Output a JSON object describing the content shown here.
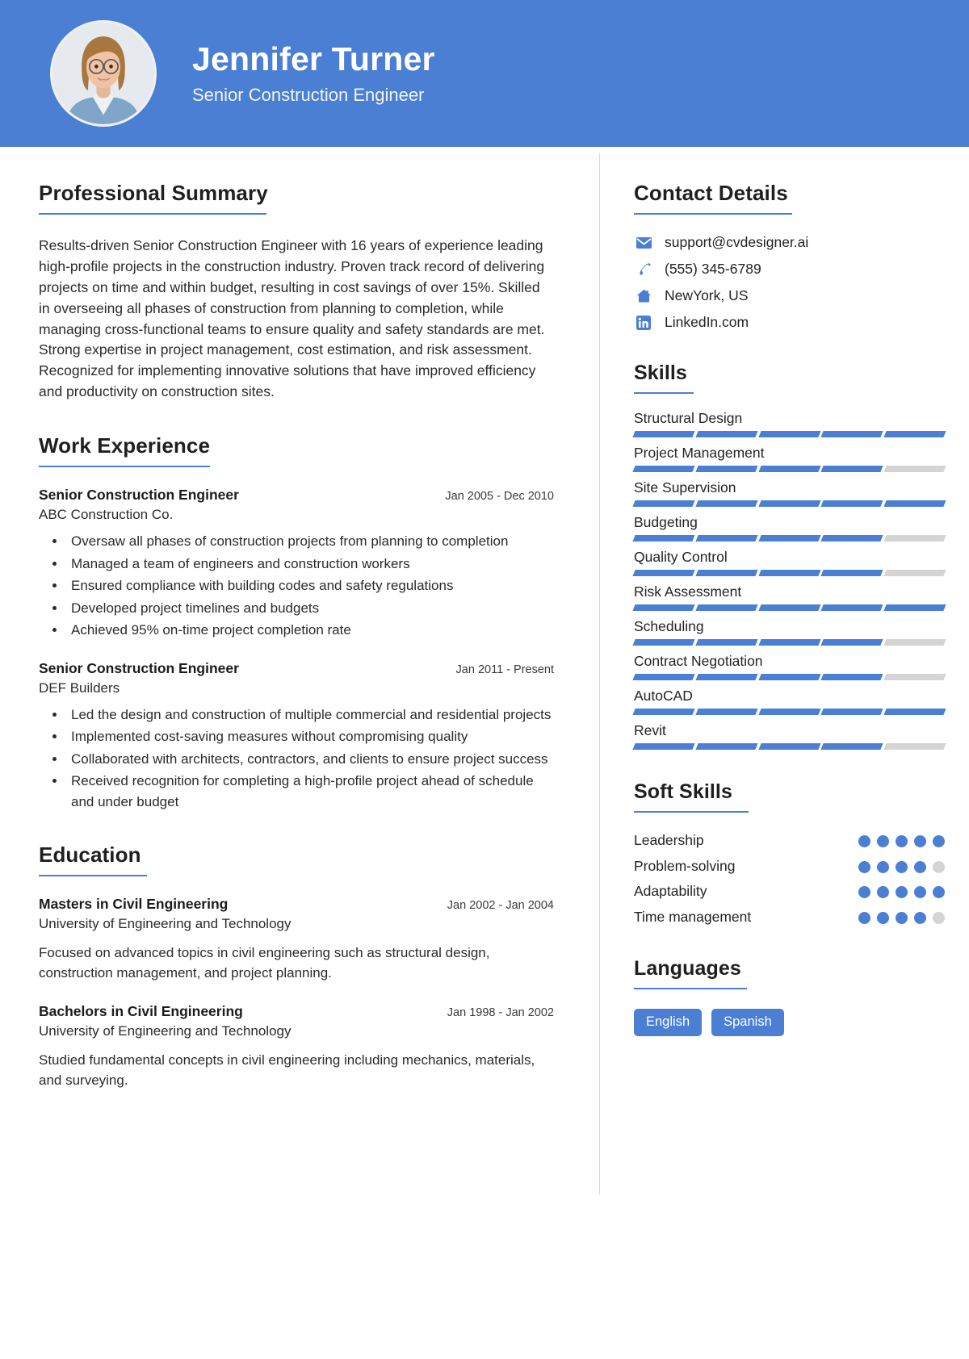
{
  "header": {
    "name": "Jennifer Turner",
    "title": "Senior Construction Engineer",
    "avatar_icon": "user-photo",
    "background_color": "#4a7fd4"
  },
  "left": {
    "summary": {
      "heading": "Professional Summary",
      "text": "Results-driven Senior Construction Engineer with 16 years of experience leading high-profile projects in the construction industry. Proven track record of delivering projects on time and within budget, resulting in cost savings of over 15%. Skilled in overseeing all phases of construction from planning to completion, while managing cross-functional teams to ensure quality and safety standards are met. Strong expertise in project management, cost estimation, and risk assessment. Recognized for implementing innovative solutions that have improved efficiency and productivity on construction sites."
    },
    "work": {
      "heading": "Work Experience",
      "jobs": [
        {
          "title": "Senior Construction Engineer",
          "date": "Jan 2005 - Dec 2010",
          "org": "ABC Construction Co.",
          "bullets": [
            "Oversaw all phases of construction projects from planning to completion",
            "Managed a team of engineers and construction workers",
            "Ensured compliance with building codes and safety regulations",
            "Developed project timelines and budgets",
            "Achieved 95% on-time project completion rate"
          ]
        },
        {
          "title": "Senior Construction Engineer",
          "date": "Jan 2011 - Present",
          "org": "DEF Builders",
          "bullets": [
            "Led the design and construction of multiple commercial and residential projects",
            "Implemented cost-saving measures without compromising quality",
            "Collaborated with architects, contractors, and clients to ensure project success",
            "Received recognition for completing a high-profile project ahead of schedule and under budget"
          ]
        }
      ]
    },
    "education": {
      "heading": "Education",
      "entries": [
        {
          "degree": "Masters in Civil Engineering",
          "date": "Jan 2002 - Jan 2004",
          "school": "University of Engineering and Technology",
          "description": "Focused on advanced topics in civil engineering such as structural design, construction management, and project planning."
        },
        {
          "degree": "Bachelors in Civil Engineering",
          "date": "Jan 1998 - Jan 2002",
          "school": "University of Engineering and Technology",
          "description": "Studied fundamental concepts in civil engineering including mechanics, materials, and surveying."
        }
      ]
    }
  },
  "right": {
    "contact": {
      "heading": "Contact Details",
      "items": [
        {
          "icon": "envelope-icon",
          "value": "support@cvdesigner.ai"
        },
        {
          "icon": "phone-icon",
          "value": "(555) 345-6789"
        },
        {
          "icon": "home-icon",
          "value": "NewYork, US"
        },
        {
          "icon": "linkedin-icon",
          "value": "LinkedIn.com"
        }
      ]
    },
    "skills": {
      "heading": "Skills",
      "max_level": 5,
      "items": [
        {
          "name": "Structural Design",
          "level": 5
        },
        {
          "name": "Project Management",
          "level": 4
        },
        {
          "name": "Site Supervision",
          "level": 5
        },
        {
          "name": "Budgeting",
          "level": 4
        },
        {
          "name": "Quality Control",
          "level": 4
        },
        {
          "name": "Risk Assessment",
          "level": 5
        },
        {
          "name": "Scheduling",
          "level": 4
        },
        {
          "name": "Contract Negotiation",
          "level": 4
        },
        {
          "name": "AutoCAD",
          "level": 5
        },
        {
          "name": "Revit",
          "level": 4
        }
      ]
    },
    "soft_skills": {
      "heading": "Soft Skills",
      "max_level": 5,
      "items": [
        {
          "name": "Leadership",
          "level": 5
        },
        {
          "name": "Problem-solving",
          "level": 4
        },
        {
          "name": "Adaptability",
          "level": 5
        },
        {
          "name": "Time management",
          "level": 4
        }
      ]
    },
    "languages": {
      "heading": "Languages",
      "items": [
        "English",
        "Spanish"
      ]
    }
  },
  "colors": {
    "accent": "#4a7fd4",
    "track": "#d4d4d4",
    "text": "#232323"
  }
}
